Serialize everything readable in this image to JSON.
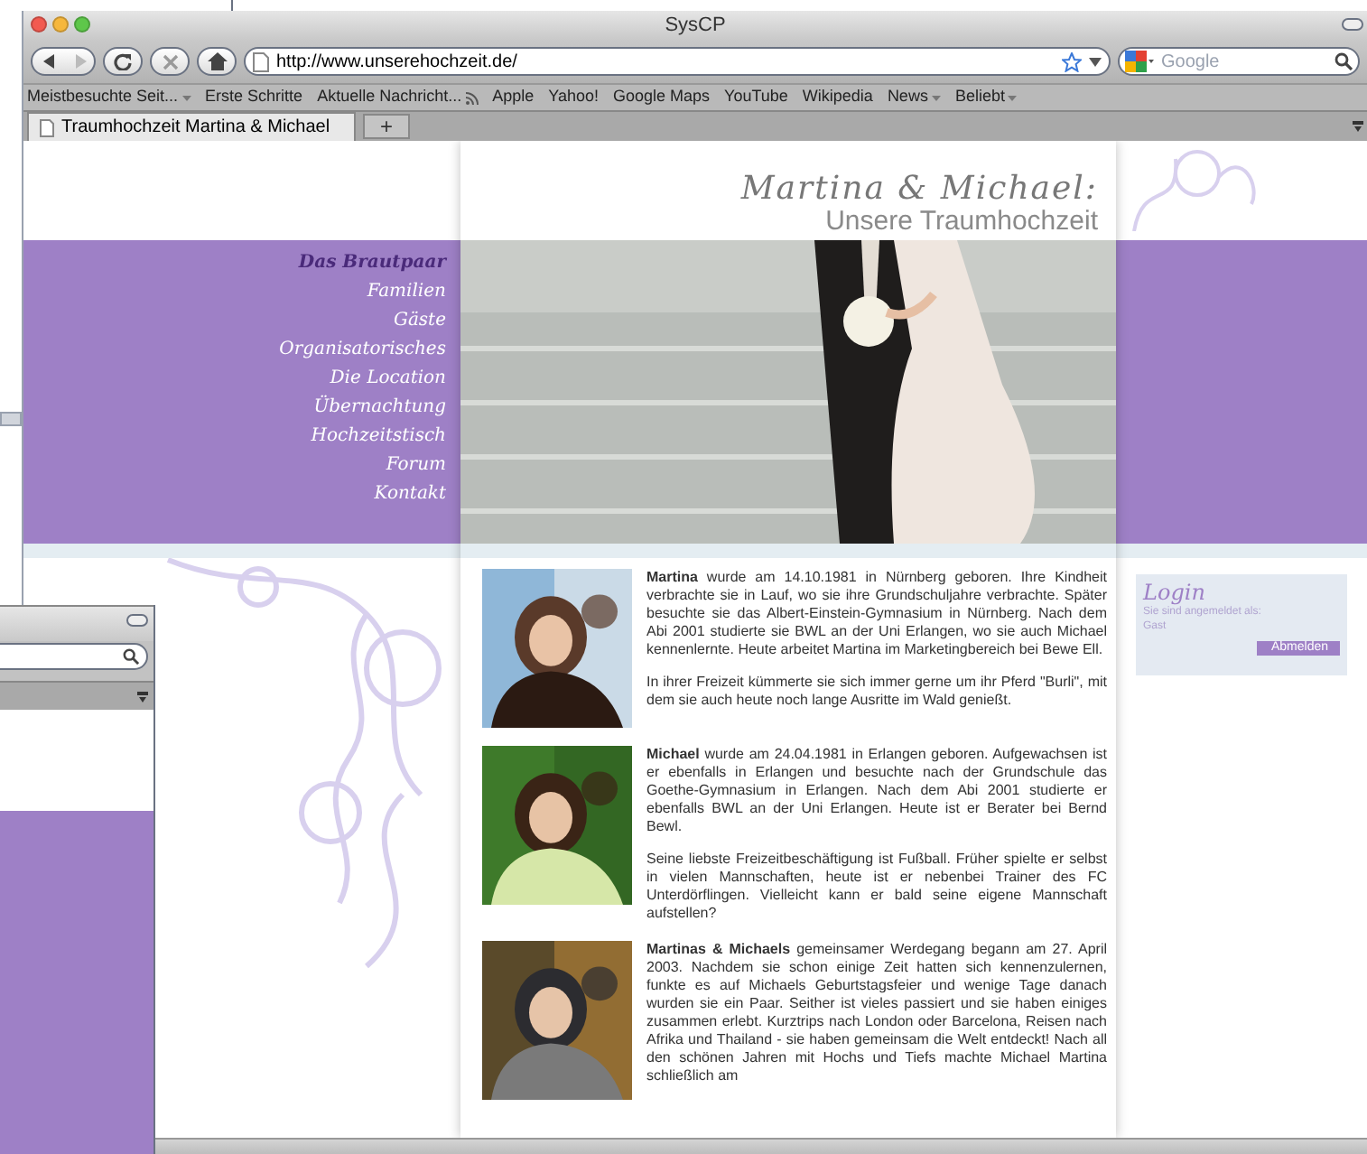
{
  "window": {
    "title": "SysCP"
  },
  "toolbar": {
    "url": "http://www.unserehochzeit.de/",
    "search_placeholder": "Google"
  },
  "bookmarks": [
    {
      "label": "Meistbesuchte Seit...",
      "kind": "folder"
    },
    {
      "label": "Erste Schritte",
      "kind": "link"
    },
    {
      "label": "Aktuelle Nachricht...",
      "kind": "feed"
    },
    {
      "label": "Apple",
      "kind": "link"
    },
    {
      "label": "Yahoo!",
      "kind": "link"
    },
    {
      "label": "Google Maps",
      "kind": "link"
    },
    {
      "label": "YouTube",
      "kind": "link"
    },
    {
      "label": "Wikipedia",
      "kind": "link"
    },
    {
      "label": "News",
      "kind": "folder"
    },
    {
      "label": "Beliebt",
      "kind": "folder"
    }
  ],
  "tabs": [
    {
      "label": "Traumhochzeit Martina & Michael",
      "selected": true
    }
  ],
  "new_tab": "+",
  "site": {
    "title": "Martina & Michael:",
    "subtitle": "Unsere Traumhochzeit",
    "nav": [
      {
        "label": "Das Brautpaar",
        "selected": true
      },
      {
        "label": "Familien",
        "selected": false
      },
      {
        "label": "Gäste",
        "selected": false
      },
      {
        "label": "Organisatorisches",
        "selected": false
      },
      {
        "label": "Die Location",
        "selected": false
      },
      {
        "label": "Übernachtung",
        "selected": false
      },
      {
        "label": "Hochzeitstisch",
        "selected": false
      },
      {
        "label": "Forum",
        "selected": false
      },
      {
        "label": "Kontakt",
        "selected": false
      }
    ],
    "articles": [
      {
        "paragraphs": [
          "**Martina** wurde am 14.10.1981 in Nürnberg geboren. Ihre Kindheit verbrachte sie in Lauf, wo sie ihre Grundschuljahre verbrachte. Später besuchte sie das Albert-Einstein-Gymnasium in Nürnberg. Nach dem Abi 2001 studierte sie BWL an der Uni Erlangen, wo sie auch Michael kennenlernte. Heute arbeitet Martina im Marketingbereich bei Bewe Ell.",
          "In ihrer Freizeit kümmerte sie sich immer gerne um ihr Pferd \"Burli\", mit dem sie auch heute noch lange Ausritte im Wald genießt."
        ]
      },
      {
        "paragraphs": [
          "**Michael** wurde am 24.04.1981 in Erlangen geboren. Aufgewachsen ist er ebenfalls in Erlangen und besuchte nach der Grundschule das Goethe-Gymnasium in Erlangen. Nach dem Abi 2001 studierte er ebenfalls BWL an der Uni Erlangen. Heute ist er Berater bei Bernd Bewl.",
          "Seine liebste Freizeitbeschäftigung ist Fußball. Früher spielte er selbst in vielen Mannschaften, heute ist er nebenbei Trainer des FC Unterdörflingen. Vielleicht kann er bald seine eigene Mannschaft aufstellen?"
        ]
      },
      {
        "paragraphs": [
          "**Martinas & Michaels** gemeinsamer Werdegang begann am 27. April 2003. Nachdem sie schon einige Zeit hatten sich kennenzulernen, funkte es auf Michaels Geburtstagsfeier und wenige Tage danach wurden sie ein Paar. Seither ist vieles passiert und sie haben einiges zusammen erlebt. Kurztrips nach London oder Barcelona, Reisen nach Afrika und Thailand - sie haben gemeinsam die Welt entdeckt! Nach all den schönen Jahren mit Hochs und Tiefs machte Michael Martina schließlich am"
        ]
      }
    ],
    "login": {
      "title": "Login",
      "status": "Sie sind angemeldet als:",
      "user": "Gast",
      "button": "Abmelden"
    }
  }
}
